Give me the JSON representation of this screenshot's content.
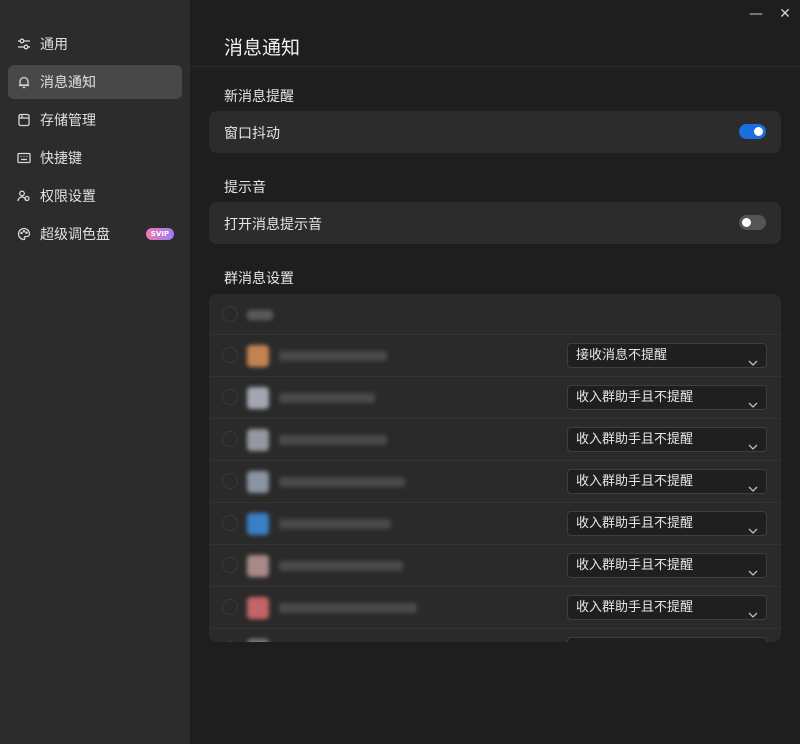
{
  "sidebar": {
    "items": [
      {
        "label": "通用",
        "icon": "sliders-icon"
      },
      {
        "label": "消息通知",
        "icon": "bell-icon",
        "active": true
      },
      {
        "label": "存储管理",
        "icon": "storage-icon"
      },
      {
        "label": "快捷键",
        "icon": "keyboard-icon"
      },
      {
        "label": "权限设置",
        "icon": "users-icon"
      },
      {
        "label": "超级调色盘",
        "icon": "palette-icon",
        "badge": "SVIP"
      }
    ]
  },
  "window": {
    "minimize": "—",
    "close": "✕"
  },
  "page": {
    "title": "消息通知"
  },
  "sections": {
    "new_message": {
      "title": "新消息提醒",
      "window_shake": {
        "label": "窗口抖动",
        "enabled": true
      }
    },
    "sound": {
      "title": "提示音",
      "open_sound": {
        "label": "打开消息提示音",
        "enabled": false
      }
    },
    "group": {
      "title": "群消息设置",
      "rows": [
        {
          "option": "接收消息不提醒",
          "avatar_color": "#e0925a"
        },
        {
          "option": "收入群助手且不提醒",
          "avatar_color": "#b8bcc8"
        },
        {
          "option": "收入群助手且不提醒",
          "avatar_color": "#a8aab6"
        },
        {
          "option": "收入群助手且不提醒",
          "avatar_color": "#9aa6b8"
        },
        {
          "option": "收入群助手且不提醒",
          "avatar_color": "#3b8fe0"
        },
        {
          "option": "收入群助手且不提醒",
          "avatar_color": "#c09a98"
        },
        {
          "option": "收入群助手且不提醒",
          "avatar_color": "#e07070"
        }
      ]
    }
  },
  "colors": {
    "accent": "#1a6fe0",
    "svip_gradient_start": "#f07ab0",
    "svip_gradient_end": "#9a7cf2"
  }
}
